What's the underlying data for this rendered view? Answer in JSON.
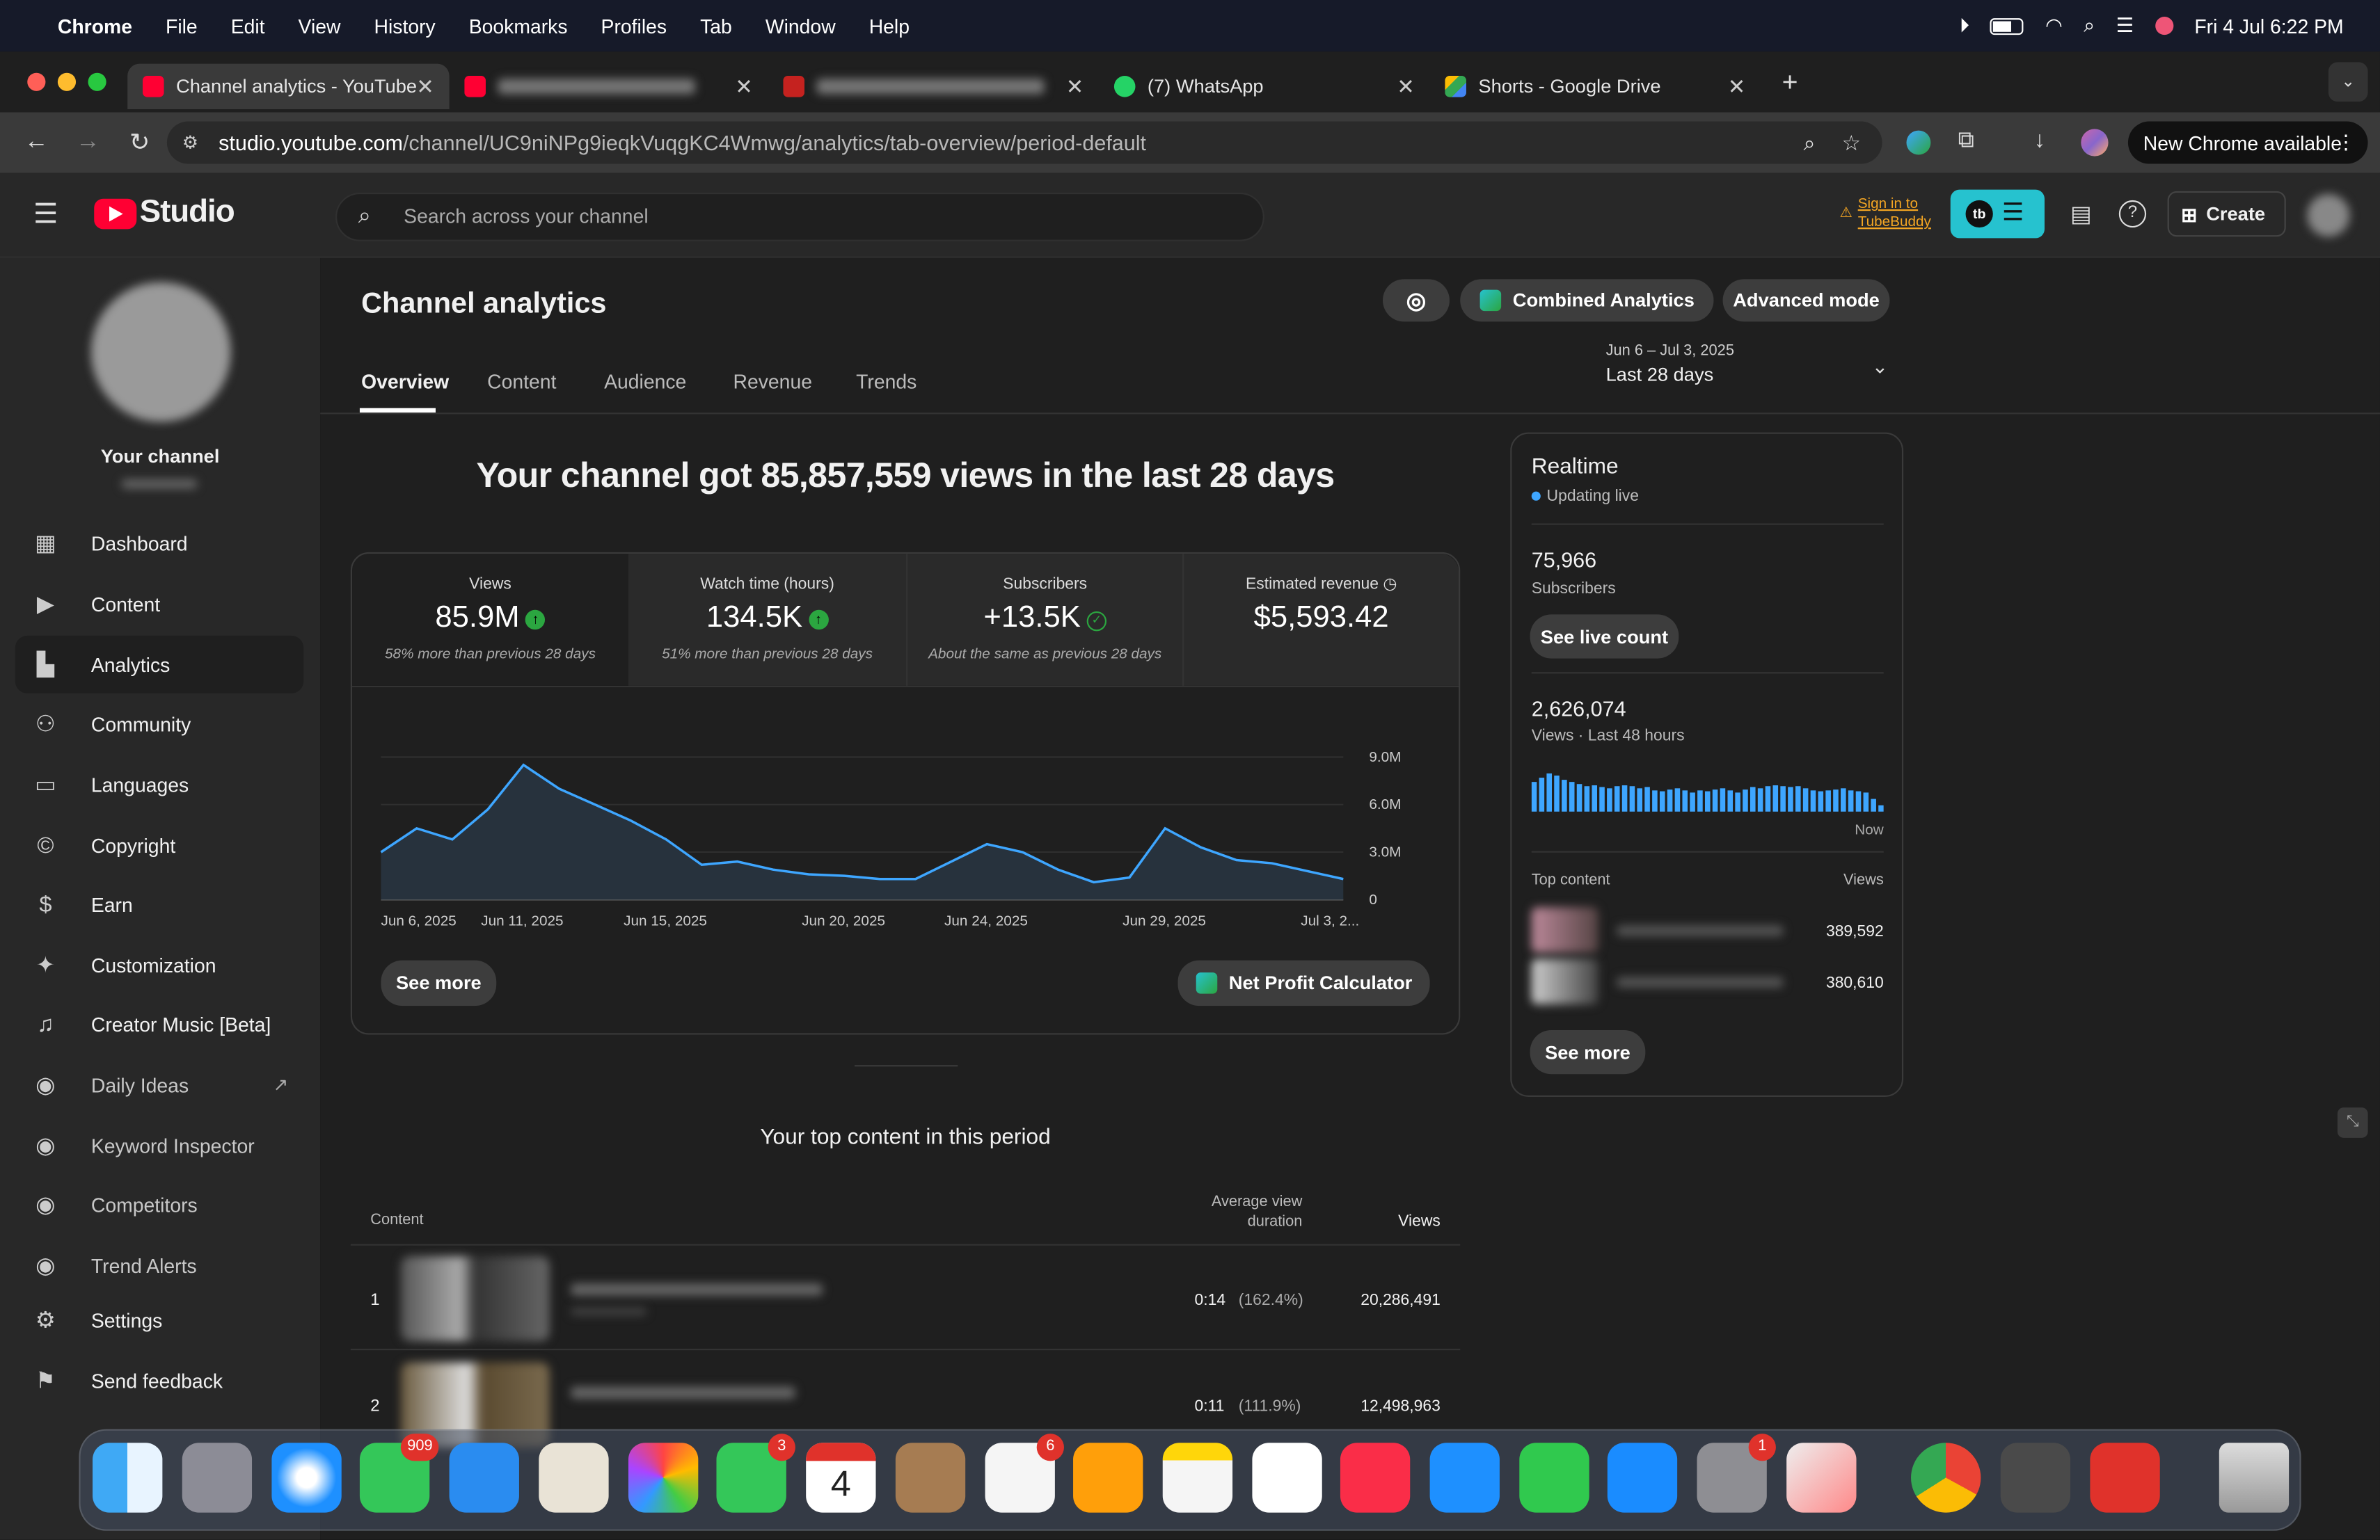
{
  "menubar": {
    "app": "Chrome",
    "items": [
      "File",
      "Edit",
      "View",
      "History",
      "Bookmarks",
      "Profiles",
      "Tab",
      "Window",
      "Help"
    ],
    "clock": "Fri 4 Jul  6:22 PM"
  },
  "tabs": [
    {
      "title": "Channel analytics - YouTube S",
      "active": true
    },
    {
      "title": "",
      "active": false
    },
    {
      "title": "",
      "active": false
    },
    {
      "title": "(7) WhatsApp",
      "active": false
    },
    {
      "title": "Shorts - Google Drive",
      "active": false
    }
  ],
  "address": {
    "host": "studio.youtube.com",
    "path": "/channel/UC9niNPg9ieqkVuqgKC4Wmwg/analytics/tab-overview/period-default",
    "new_chrome": "New Chrome available"
  },
  "studio": {
    "logo": "Studio",
    "search_placeholder": "Search across your channel",
    "tubebuddy_line1": "Sign in to",
    "tubebuddy_line2": "TubeBuddy",
    "tb_badge": "tb",
    "create": "Create"
  },
  "sidebar": {
    "channel_label": "Your channel",
    "items": [
      {
        "label": "Dashboard",
        "icon": "dashboard-icon"
      },
      {
        "label": "Content",
        "icon": "content-icon"
      },
      {
        "label": "Analytics",
        "icon": "analytics-icon"
      },
      {
        "label": "Community",
        "icon": "community-icon"
      },
      {
        "label": "Languages",
        "icon": "languages-icon"
      },
      {
        "label": "Copyright",
        "icon": "copyright-icon"
      },
      {
        "label": "Earn",
        "icon": "earn-icon"
      },
      {
        "label": "Customization",
        "icon": "customization-icon"
      },
      {
        "label": "Creator Music [Beta]",
        "icon": "music-icon"
      },
      {
        "label": "Daily Ideas",
        "icon": "iq-icon"
      },
      {
        "label": "Keyword Inspector",
        "icon": "iq-icon"
      },
      {
        "label": "Competitors",
        "icon": "iq-icon"
      },
      {
        "label": "Trend Alerts",
        "icon": "iq-icon"
      },
      {
        "label": "Settings",
        "icon": "gear-icon"
      },
      {
        "label": "Send feedback",
        "icon": "feedback-icon"
      }
    ]
  },
  "analytics": {
    "title": "Channel analytics",
    "combined": "Combined Analytics",
    "advanced": "Advanced mode",
    "tabs": [
      "Overview",
      "Content",
      "Audience",
      "Revenue",
      "Trends"
    ],
    "period_range": "Jun 6 – Jul 3, 2025",
    "period_label": "Last 28 days",
    "headline": "Your channel got 85,857,559 views in the last 28 days",
    "metrics": [
      {
        "label": "Views",
        "value": "85.9M",
        "sub": "58% more than previous 28 days"
      },
      {
        "label": "Watch time (hours)",
        "value": "134.5K",
        "sub": "51% more than previous 28 days"
      },
      {
        "label": "Subscribers",
        "value": "+13.5K",
        "sub": "About the same as previous 28 days"
      },
      {
        "label": "Estimated revenue",
        "value": "$5,593.42",
        "sub": ""
      }
    ],
    "see_more": "See more",
    "net_profit": "Net Profit Calculator",
    "top_content_title": "Your top content in this period",
    "col_content": "Content",
    "col_avd_1": "Average view",
    "col_avd_2": "duration",
    "col_views": "Views",
    "rows": [
      {
        "rank": "1",
        "avd": "0:14",
        "pct": "(162.4%)",
        "views": "20,286,491"
      },
      {
        "rank": "2",
        "avd": "0:11",
        "pct": "(111.9%)",
        "views": "12,498,963"
      }
    ]
  },
  "realtime": {
    "title": "Realtime",
    "live": "Updating live",
    "subs": "75,966",
    "subs_label": "Subscribers",
    "live_count": "See live count",
    "views": "2,626,074",
    "views_label": "Views · Last 48 hours",
    "now": "Now",
    "top_content": "Top content",
    "top_views": "Views",
    "items": [
      "389,592",
      "380,610"
    ],
    "see_more": "See more",
    "bars": [
      0.7,
      0.8,
      0.9,
      0.85,
      0.75,
      0.7,
      0.65,
      0.6,
      0.62,
      0.58,
      0.55,
      0.6,
      0.62,
      0.6,
      0.55,
      0.58,
      0.5,
      0.48,
      0.52,
      0.55,
      0.5,
      0.45,
      0.5,
      0.48,
      0.52,
      0.55,
      0.5,
      0.45,
      0.52,
      0.58,
      0.55,
      0.6,
      0.62,
      0.6,
      0.58,
      0.6,
      0.55,
      0.5,
      0.48,
      0.5,
      0.52,
      0.55,
      0.5,
      0.48,
      0.45,
      0.3,
      0.15
    ]
  },
  "chart_data": {
    "type": "area",
    "x": [
      "Jun 6, 2025",
      "Jun 7",
      "Jun 8",
      "Jun 9",
      "Jun 10",
      "Jun 11, 2025",
      "Jun 12",
      "Jun 13",
      "Jun 14",
      "Jun 15, 2025",
      "Jun 16",
      "Jun 17",
      "Jun 18",
      "Jun 19",
      "Jun 20, 2025",
      "Jun 21",
      "Jun 22",
      "Jun 23",
      "Jun 24, 2025",
      "Jun 25",
      "Jun 26",
      "Jun 27",
      "Jun 28",
      "Jun 29, 2025",
      "Jun 30",
      "Jul 1",
      "Jul 2",
      "Jul 3, 2025"
    ],
    "x_tick_labels": [
      "Jun 6, 2025",
      "Jun 11, 2025",
      "Jun 15, 2025",
      "Jun 20, 2025",
      "Jun 24, 2025",
      "Jun 29, 2025",
      "Jul 3, 2..."
    ],
    "x_tick_index": [
      0,
      4,
      8,
      13,
      17,
      22,
      27
    ],
    "series": [
      {
        "values": [
          3.0,
          4.5,
          3.8,
          5.7,
          8.5,
          7.0,
          6.0,
          5.0,
          3.8,
          2.2,
          2.4,
          1.9,
          1.6,
          1.5,
          1.3,
          1.3,
          2.4,
          3.5,
          3.0,
          1.9,
          1.1,
          1.4,
          4.5,
          3.3,
          2.5,
          2.3,
          1.8,
          1.3
        ]
      }
    ],
    "y_ticks": [
      "9.0M",
      "6.0M",
      "3.0M",
      "0"
    ],
    "ylim": [
      0,
      9
    ],
    "ylabel": "",
    "colors": {
      "line": "#3ea6ff",
      "fill": "#27323d"
    }
  }
}
